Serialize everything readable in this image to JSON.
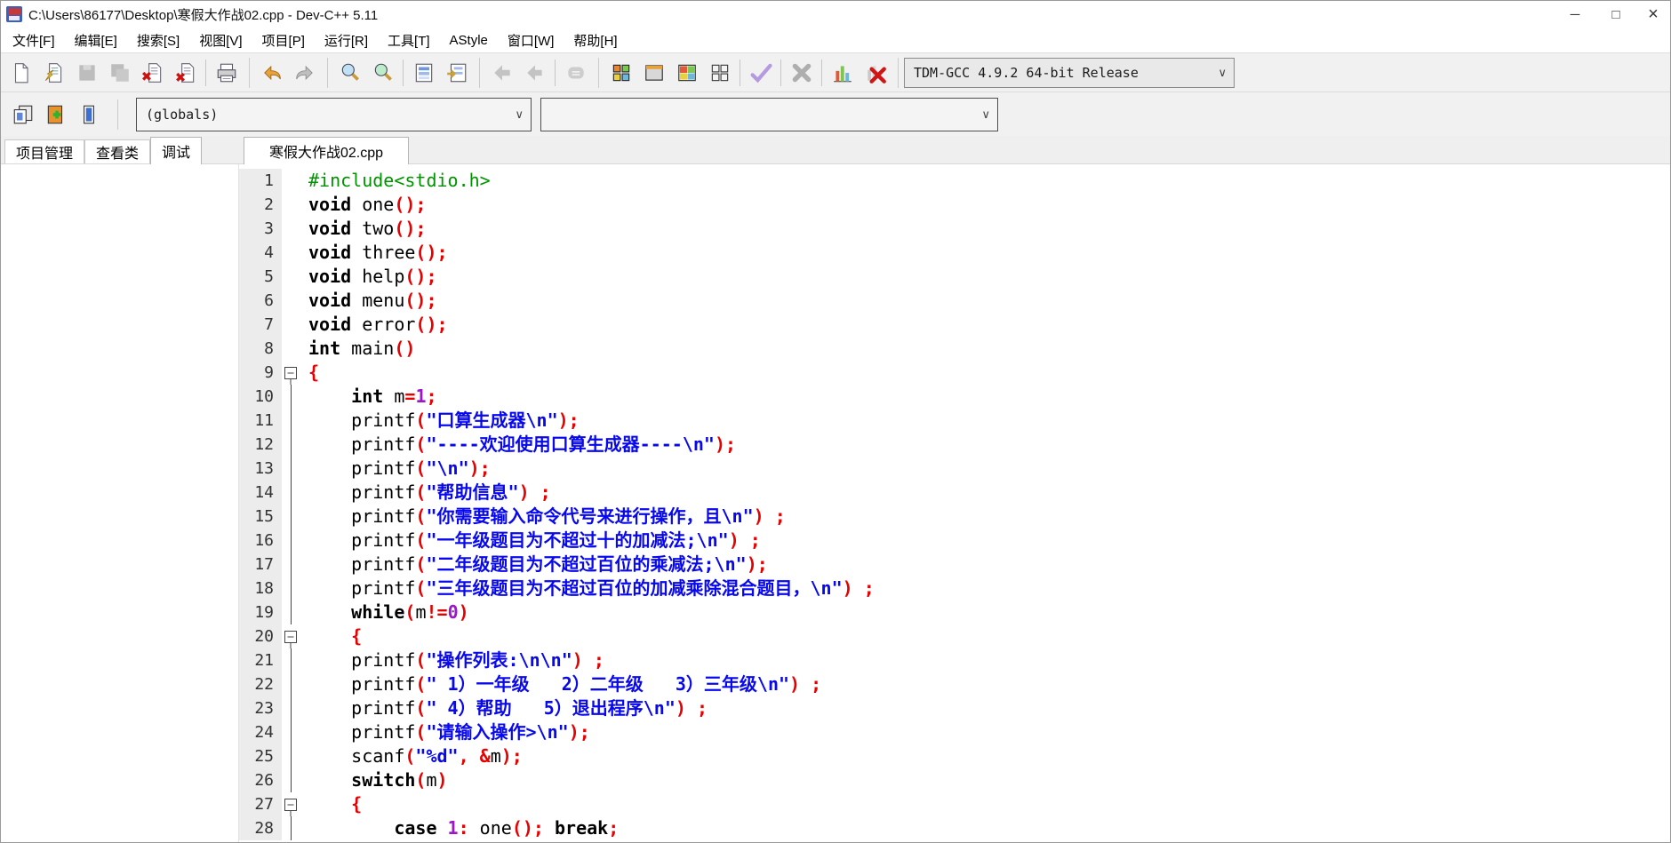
{
  "window": {
    "title": "C:\\Users\\86177\\Desktop\\寒假大作战02.cpp - Dev-C++ 5.11",
    "controls": {
      "minimize": "─",
      "maximize": "□",
      "close": "×"
    }
  },
  "icons": {
    "chevron_down": "∨"
  },
  "menu": {
    "items": [
      {
        "label": "文件[F]"
      },
      {
        "label": "编辑[E]"
      },
      {
        "label": "搜索[S]"
      },
      {
        "label": "视图[V]"
      },
      {
        "label": "项目[P]"
      },
      {
        "label": "运行[R]"
      },
      {
        "label": "工具[T]"
      },
      {
        "label": "AStyle"
      },
      {
        "label": "窗口[W]"
      },
      {
        "label": "帮助[H]"
      }
    ]
  },
  "toolbar": {
    "compiler_label": "TDM-GCC 4.9.2 64-bit Release",
    "globals_label": "(globals)",
    "member_label": ""
  },
  "panel_tabs": [
    {
      "label": "项目管理",
      "active": false
    },
    {
      "label": "查看类",
      "active": false
    },
    {
      "label": "调试",
      "active": true
    }
  ],
  "editor": {
    "tab_label": "寒假大作战02.cpp",
    "lines": [
      {
        "n": 1,
        "fold": "none",
        "tokens": [
          [
            "pre",
            "#include<stdio.h>"
          ]
        ]
      },
      {
        "n": 2,
        "fold": "none",
        "tokens": [
          [
            "kw",
            "void"
          ],
          [
            "id",
            " one"
          ],
          [
            "sym",
            "();"
          ]
        ]
      },
      {
        "n": 3,
        "fold": "none",
        "tokens": [
          [
            "kw",
            "void"
          ],
          [
            "id",
            " two"
          ],
          [
            "sym",
            "();"
          ]
        ]
      },
      {
        "n": 4,
        "fold": "none",
        "tokens": [
          [
            "kw",
            "void"
          ],
          [
            "id",
            " three"
          ],
          [
            "sym",
            "();"
          ]
        ]
      },
      {
        "n": 5,
        "fold": "none",
        "tokens": [
          [
            "kw",
            "void"
          ],
          [
            "id",
            " help"
          ],
          [
            "sym",
            "();"
          ]
        ]
      },
      {
        "n": 6,
        "fold": "none",
        "tokens": [
          [
            "kw",
            "void"
          ],
          [
            "id",
            " menu"
          ],
          [
            "sym",
            "();"
          ]
        ]
      },
      {
        "n": 7,
        "fold": "none",
        "tokens": [
          [
            "kw",
            "void"
          ],
          [
            "id",
            " error"
          ],
          [
            "sym",
            "();"
          ]
        ]
      },
      {
        "n": 8,
        "fold": "none",
        "tokens": [
          [
            "kw",
            "int"
          ],
          [
            "id",
            " main"
          ],
          [
            "sym",
            "()"
          ]
        ]
      },
      {
        "n": 9,
        "fold": "box",
        "tokens": [
          [
            "sym",
            "{"
          ]
        ]
      },
      {
        "n": 10,
        "fold": "line",
        "tokens": [
          [
            "id",
            "    "
          ],
          [
            "kw",
            "int"
          ],
          [
            "id",
            " m"
          ],
          [
            "sym",
            "="
          ],
          [
            "num",
            "1"
          ],
          [
            "sym",
            ";"
          ]
        ]
      },
      {
        "n": 11,
        "fold": "line",
        "tokens": [
          [
            "id",
            "    printf"
          ],
          [
            "sym",
            "("
          ],
          [
            "str",
            "\"口算生成器\\n\""
          ],
          [
            "sym",
            ");"
          ]
        ]
      },
      {
        "n": 12,
        "fold": "line",
        "tokens": [
          [
            "id",
            "    printf"
          ],
          [
            "sym",
            "("
          ],
          [
            "str",
            "\"----欢迎使用口算生成器----\\n\""
          ],
          [
            "sym",
            ");"
          ]
        ]
      },
      {
        "n": 13,
        "fold": "line",
        "tokens": [
          [
            "id",
            "    printf"
          ],
          [
            "sym",
            "("
          ],
          [
            "str",
            "\"\\n\""
          ],
          [
            "sym",
            ");"
          ]
        ]
      },
      {
        "n": 14,
        "fold": "line",
        "tokens": [
          [
            "id",
            "    printf"
          ],
          [
            "sym",
            "("
          ],
          [
            "str",
            "\"帮助信息\""
          ],
          [
            "sym",
            ") ;"
          ]
        ]
      },
      {
        "n": 15,
        "fold": "line",
        "tokens": [
          [
            "id",
            "    printf"
          ],
          [
            "sym",
            "("
          ],
          [
            "str",
            "\"你需要输入命令代号来进行操作，且\\n\""
          ],
          [
            "sym",
            ") ;"
          ]
        ]
      },
      {
        "n": 16,
        "fold": "line",
        "tokens": [
          [
            "id",
            "    printf"
          ],
          [
            "sym",
            "("
          ],
          [
            "str",
            "\"一年级题目为不超过十的加减法;\\n\""
          ],
          [
            "sym",
            ") ;"
          ]
        ]
      },
      {
        "n": 17,
        "fold": "line",
        "tokens": [
          [
            "id",
            "    printf"
          ],
          [
            "sym",
            "("
          ],
          [
            "str",
            "\"二年级题目为不超过百位的乘减法;\\n\""
          ],
          [
            "sym",
            ");"
          ]
        ]
      },
      {
        "n": 18,
        "fold": "line",
        "tokens": [
          [
            "id",
            "    printf"
          ],
          [
            "sym",
            "("
          ],
          [
            "str",
            "\"三年级题目为不超过百位的加减乘除混合题目，\\n\""
          ],
          [
            "sym",
            ") ;"
          ]
        ]
      },
      {
        "n": 19,
        "fold": "line",
        "tokens": [
          [
            "id",
            "    "
          ],
          [
            "kw",
            "while"
          ],
          [
            "sym",
            "("
          ],
          [
            "id",
            "m"
          ],
          [
            "sym",
            "!="
          ],
          [
            "num",
            "0"
          ],
          [
            "sym",
            ")"
          ]
        ]
      },
      {
        "n": 20,
        "fold": "box",
        "tokens": [
          [
            "id",
            "    "
          ],
          [
            "sym",
            "{"
          ]
        ]
      },
      {
        "n": 21,
        "fold": "line",
        "tokens": [
          [
            "id",
            "    printf"
          ],
          [
            "sym",
            "("
          ],
          [
            "str",
            "\"操作列表:\\n\\n\""
          ],
          [
            "sym",
            ") ;"
          ]
        ]
      },
      {
        "n": 22,
        "fold": "line",
        "tokens": [
          [
            "id",
            "    printf"
          ],
          [
            "sym",
            "("
          ],
          [
            "str",
            "\" 1）一年级   2）二年级   3）三年级\\n\""
          ],
          [
            "sym",
            ") ;"
          ]
        ]
      },
      {
        "n": 23,
        "fold": "line",
        "tokens": [
          [
            "id",
            "    printf"
          ],
          [
            "sym",
            "("
          ],
          [
            "str",
            "\" 4）帮助   5）退出程序\\n\""
          ],
          [
            "sym",
            ") ;"
          ]
        ]
      },
      {
        "n": 24,
        "fold": "line",
        "tokens": [
          [
            "id",
            "    printf"
          ],
          [
            "sym",
            "("
          ],
          [
            "str",
            "\"请输入操作>\\n\""
          ],
          [
            "sym",
            ");"
          ]
        ]
      },
      {
        "n": 25,
        "fold": "line",
        "tokens": [
          [
            "id",
            "    scanf"
          ],
          [
            "sym",
            "("
          ],
          [
            "str",
            "\"%d\""
          ],
          [
            "sym",
            ", &"
          ],
          [
            "id",
            "m"
          ],
          [
            "sym",
            ");"
          ]
        ]
      },
      {
        "n": 26,
        "fold": "line",
        "tokens": [
          [
            "id",
            "    "
          ],
          [
            "kw",
            "switch"
          ],
          [
            "sym",
            "("
          ],
          [
            "id",
            "m"
          ],
          [
            "sym",
            ")"
          ]
        ]
      },
      {
        "n": 27,
        "fold": "box",
        "tokens": [
          [
            "id",
            "    "
          ],
          [
            "sym",
            "{"
          ]
        ]
      },
      {
        "n": 28,
        "fold": "line",
        "tokens": [
          [
            "id",
            "        "
          ],
          [
            "kw",
            "case"
          ],
          [
            "id",
            " "
          ],
          [
            "num",
            "1"
          ],
          [
            "sym",
            ":"
          ],
          [
            "id",
            " one"
          ],
          [
            "sym",
            "();"
          ],
          [
            "id",
            " "
          ],
          [
            "kw",
            "break"
          ],
          [
            "sym",
            ";"
          ]
        ]
      }
    ]
  }
}
